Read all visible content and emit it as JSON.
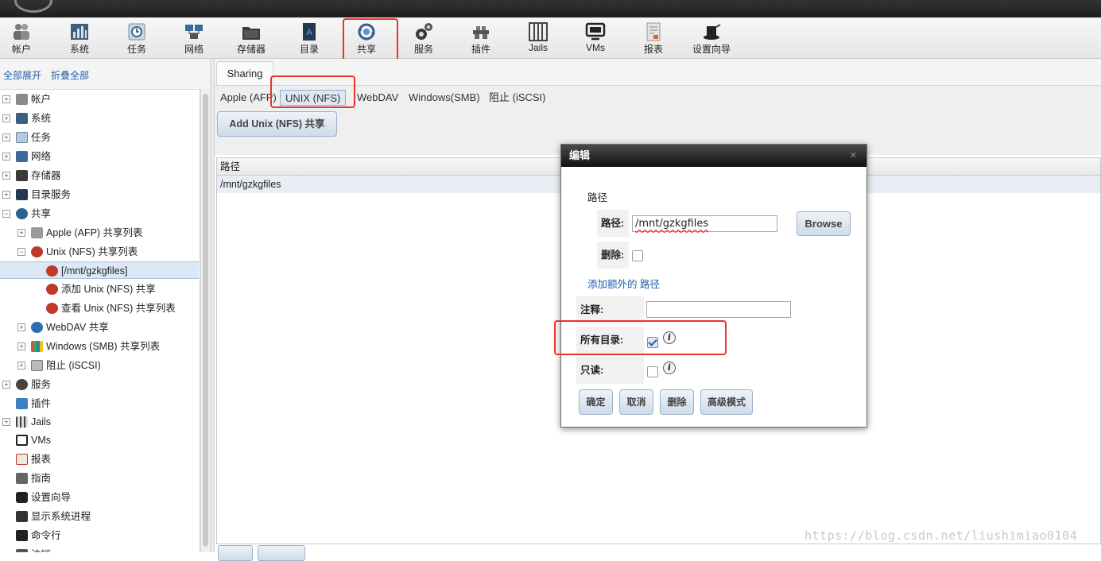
{
  "toolbar": {
    "items": [
      {
        "label": "帐户",
        "icon": "users-icon"
      },
      {
        "label": "系统",
        "icon": "system-icon"
      },
      {
        "label": "任务",
        "icon": "tasks-icon"
      },
      {
        "label": "网络",
        "icon": "network-icon"
      },
      {
        "label": "存储器",
        "icon": "storage-icon"
      },
      {
        "label": "目录",
        "icon": "directory-icon"
      },
      {
        "label": "共享",
        "icon": "sharing-icon"
      },
      {
        "label": "服务",
        "icon": "services-icon"
      },
      {
        "label": "插件",
        "icon": "plugins-icon"
      },
      {
        "label": "Jails",
        "icon": "jails-icon"
      },
      {
        "label": "VMs",
        "icon": "vms-icon"
      },
      {
        "label": "报表",
        "icon": "reports-icon"
      },
      {
        "label": "设置向导",
        "icon": "wizard-icon"
      }
    ]
  },
  "sidebar": {
    "expand_all": "全部展开",
    "collapse_all": "折叠全部",
    "tree": [
      {
        "label": "帐户"
      },
      {
        "label": "系统"
      },
      {
        "label": "任务"
      },
      {
        "label": "网络"
      },
      {
        "label": "存储器"
      },
      {
        "label": "目录服务"
      },
      {
        "label": "共享"
      },
      {
        "label": "Apple (AFP) 共享列表"
      },
      {
        "label": "Unix (NFS) 共享列表"
      },
      {
        "label": "[/mnt/gzkgfiles]"
      },
      {
        "label": "添加 Unix (NFS) 共享"
      },
      {
        "label": "查看 Unix (NFS) 共享列表"
      },
      {
        "label": "WebDAV 共享"
      },
      {
        "label": "Windows (SMB) 共享列表"
      },
      {
        "label": "阻止 (iSCSI)"
      },
      {
        "label": "服务"
      },
      {
        "label": "插件"
      },
      {
        "label": "Jails"
      },
      {
        "label": "VMs"
      },
      {
        "label": "报表"
      },
      {
        "label": "指南"
      },
      {
        "label": "设置向导"
      },
      {
        "label": "显示系统进程"
      },
      {
        "label": "命令行"
      },
      {
        "label": "注销"
      }
    ]
  },
  "main": {
    "tab": "Sharing",
    "subtabs": [
      "Apple (AFP)",
      "UNIX (NFS)",
      "WebDAV",
      "Windows(SMB)",
      "阻止 (iSCSI)"
    ],
    "add_button": "Add Unix (NFS) 共享",
    "table": {
      "header": "路径",
      "rows": [
        "/mnt/gzkgfiles"
      ]
    }
  },
  "dialog": {
    "title": "编辑",
    "section_label": "路径",
    "path_label": "路径:",
    "path_value": "/mnt/gzkgfiles",
    "browse": "Browse",
    "delete_label": "删除:",
    "add_more_link": "添加额外的 路径",
    "comment_label": "注释:",
    "comment_value": "",
    "all_dirs_label": "所有目录:",
    "all_dirs_checked": true,
    "readonly_label": "只读:",
    "readonly_checked": false,
    "buttons": {
      "ok": "确定",
      "cancel": "取消",
      "delete": "删除",
      "advanced": "高级模式"
    }
  },
  "watermark": "https://blog.csdn.net/liushimiao0104",
  "colors": {
    "highlight": "#e8332f",
    "link": "#1f5fa8"
  }
}
